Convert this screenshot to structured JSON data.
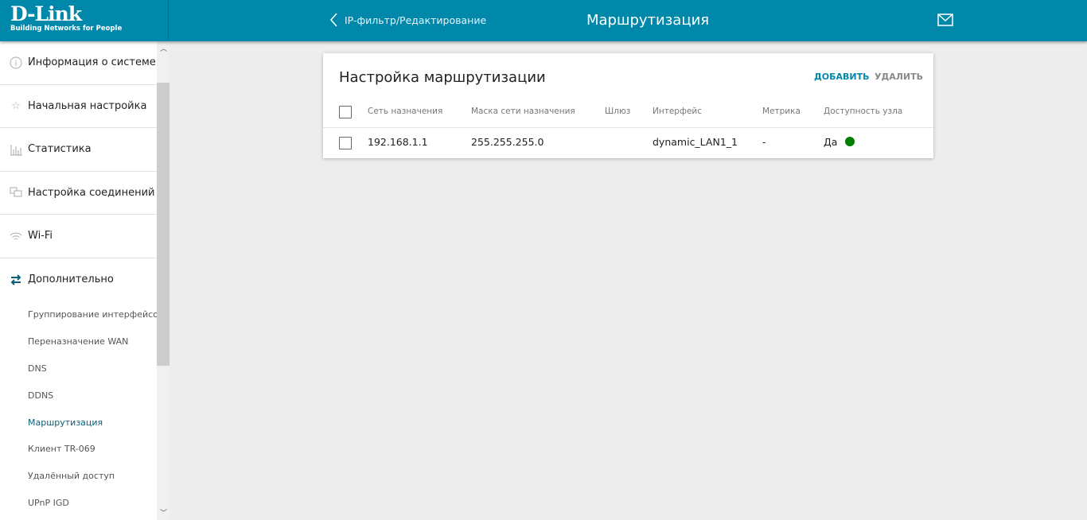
{
  "header": {
    "logo_main": "D-Link",
    "logo_tagline": "Building Networks for People",
    "back_label": "IP-фильтр/Редактирование",
    "title": "Маршрутизация"
  },
  "sidebar": {
    "items": [
      {
        "label": "Информация о системе",
        "icon": "info-icon"
      },
      {
        "label": "Начальная настройка",
        "icon": "star-icon"
      },
      {
        "label": "Статистика",
        "icon": "bar-chart-icon"
      },
      {
        "label": "Настройка соединений",
        "icon": "connections-icon"
      },
      {
        "label": "Wi-Fi",
        "icon": "wifi-icon"
      },
      {
        "label": "Дополнительно",
        "icon": "swap-icon"
      }
    ],
    "subitems": [
      "Группирование интерфейсов",
      "Переназначение WAN",
      "DNS",
      "DDNS",
      "Маршрутизация",
      "Клиент TR-069",
      "Удалённый доступ",
      "UPnP IGD"
    ],
    "active_subitem": "Маршрутизация"
  },
  "card": {
    "title": "Настройка маршрутизации",
    "add_label": "ДОБАВИТЬ",
    "delete_label": "УДАЛИТЬ",
    "columns": [
      "Сеть назначения",
      "Маска сети назначения",
      "Шлюз",
      "Интерфейс",
      "Метрика",
      "Доступность узла"
    ],
    "rows": [
      {
        "network": "192.168.1.1",
        "mask": "255.255.255.0",
        "gateway": "",
        "interface": "dynamic_LAN1_1",
        "metric": "-",
        "availability": "Да",
        "status_color": "#008000"
      }
    ]
  },
  "colors": {
    "accent": "#0088aa",
    "active": "#0a5f78"
  }
}
